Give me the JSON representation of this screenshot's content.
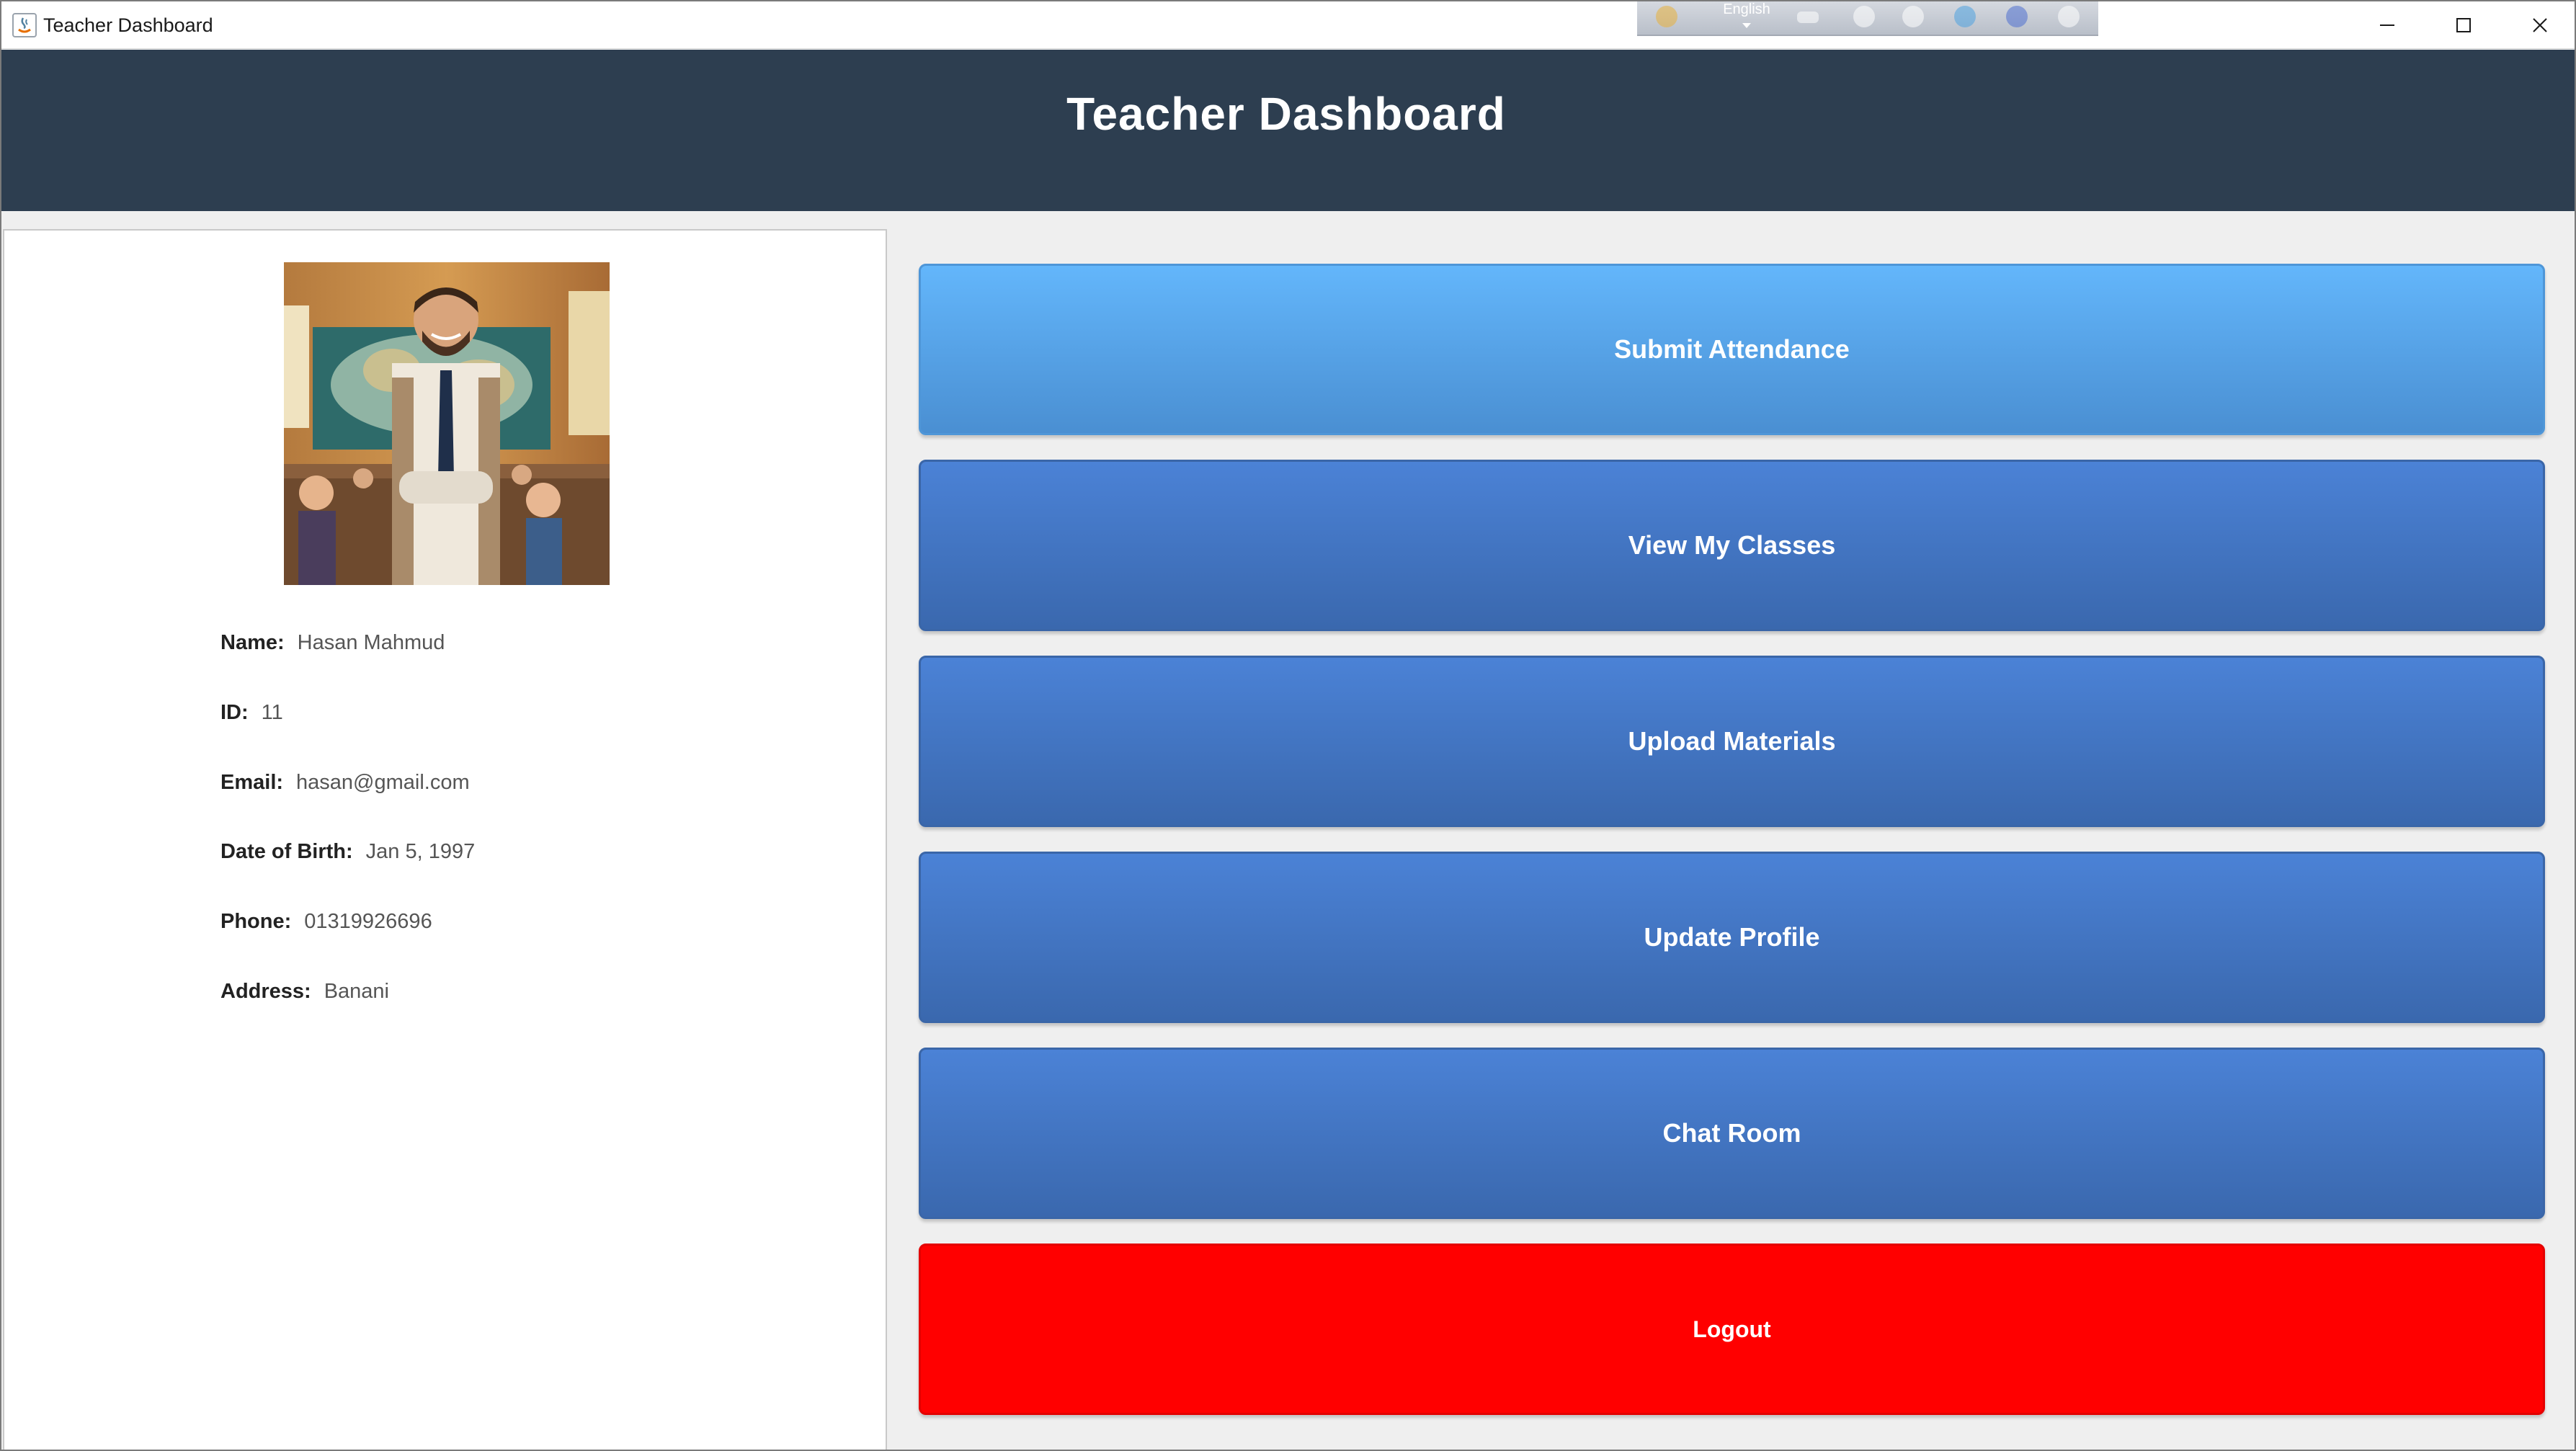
{
  "window": {
    "title": "Teacher Dashboard",
    "controls": {
      "minimize": "minimize",
      "maximize": "maximize",
      "close": "close"
    }
  },
  "ime_toolbar": {
    "language": "English"
  },
  "header": {
    "title": "Teacher Dashboard"
  },
  "profile": {
    "rows": [
      {
        "label": "Name:",
        "value": "Hasan Mahmud"
      },
      {
        "label": "ID:",
        "value": "11"
      },
      {
        "label": "Email:",
        "value": "hasan@gmail.com"
      },
      {
        "label": "Date of Birth:",
        "value": "Jan 5, 1997"
      },
      {
        "label": "Phone:",
        "value": "01319926696"
      },
      {
        "label": "Address:",
        "value": "Banani"
      }
    ]
  },
  "actions": [
    {
      "label": "Submit Attendance"
    },
    {
      "label": "View My Classes"
    },
    {
      "label": "Upload Materials"
    },
    {
      "label": "Update Profile"
    },
    {
      "label": "Chat Room"
    },
    {
      "label": "Logout"
    }
  ],
  "colors": {
    "header_bg": "#2d3e50",
    "button_blue": "#3f74c4",
    "button_light_blue": "#5aa8f0",
    "logout_red": "#ff0000"
  }
}
